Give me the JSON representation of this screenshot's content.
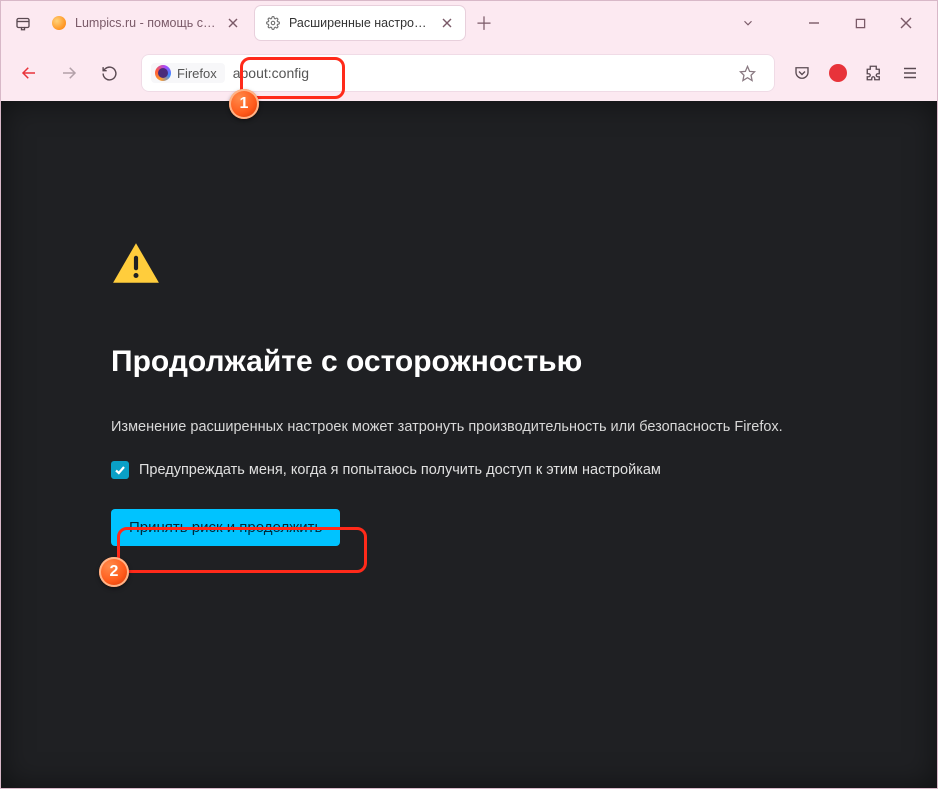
{
  "tabs": {
    "inactive": {
      "title": "Lumpics.ru - помощь с компьютером"
    },
    "active": {
      "title": "Расширенные настройки"
    }
  },
  "urlbar": {
    "badge": "Firefox",
    "url": "about:config"
  },
  "page": {
    "heading": "Продолжайте с осторожностью",
    "description": "Изменение расширенных настроек может затронуть производительность или безопасность Firefox.",
    "checkbox_label": "Предупреждать меня, когда я попытаюсь получить доступ к этим настройкам",
    "accept_button": "Принять риск и продолжить"
  },
  "annotations": {
    "step1": "1",
    "step2": "2"
  }
}
